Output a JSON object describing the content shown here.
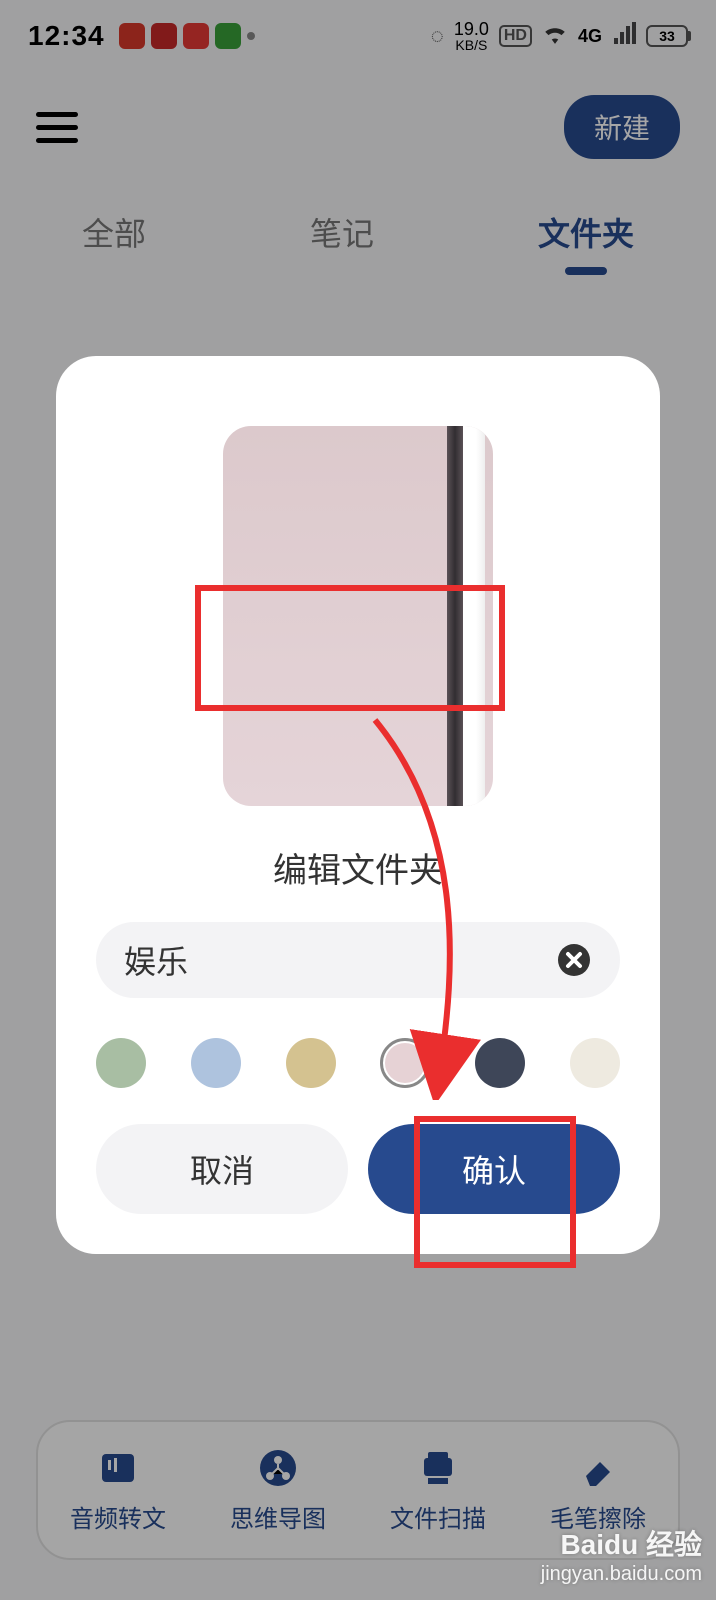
{
  "status": {
    "time": "12:34",
    "speed_value": "19.0",
    "speed_unit": "KB/S",
    "hd": "HD",
    "net_gen": "4G",
    "battery": "33"
  },
  "header": {
    "new_label": "新建"
  },
  "tabs": {
    "all": "全部",
    "notes": "笔记",
    "folders": "文件夹"
  },
  "modal": {
    "title": "编辑文件夹",
    "name_value": "娱乐",
    "cancel": "取消",
    "confirm": "确认",
    "colors": [
      "#a8bea3",
      "#aec3de",
      "#d4c290",
      "#e6d2d5",
      "#3e4658",
      "#eeeae0"
    ],
    "selected_color_index": 3
  },
  "toolbar": {
    "audio": "音频转文",
    "mindmap": "思维导图",
    "scan": "文件扫描",
    "erase": "毛笔擦除"
  },
  "watermark": {
    "brand": "Baidu 经验",
    "url": "jingyan.baidu.com"
  }
}
